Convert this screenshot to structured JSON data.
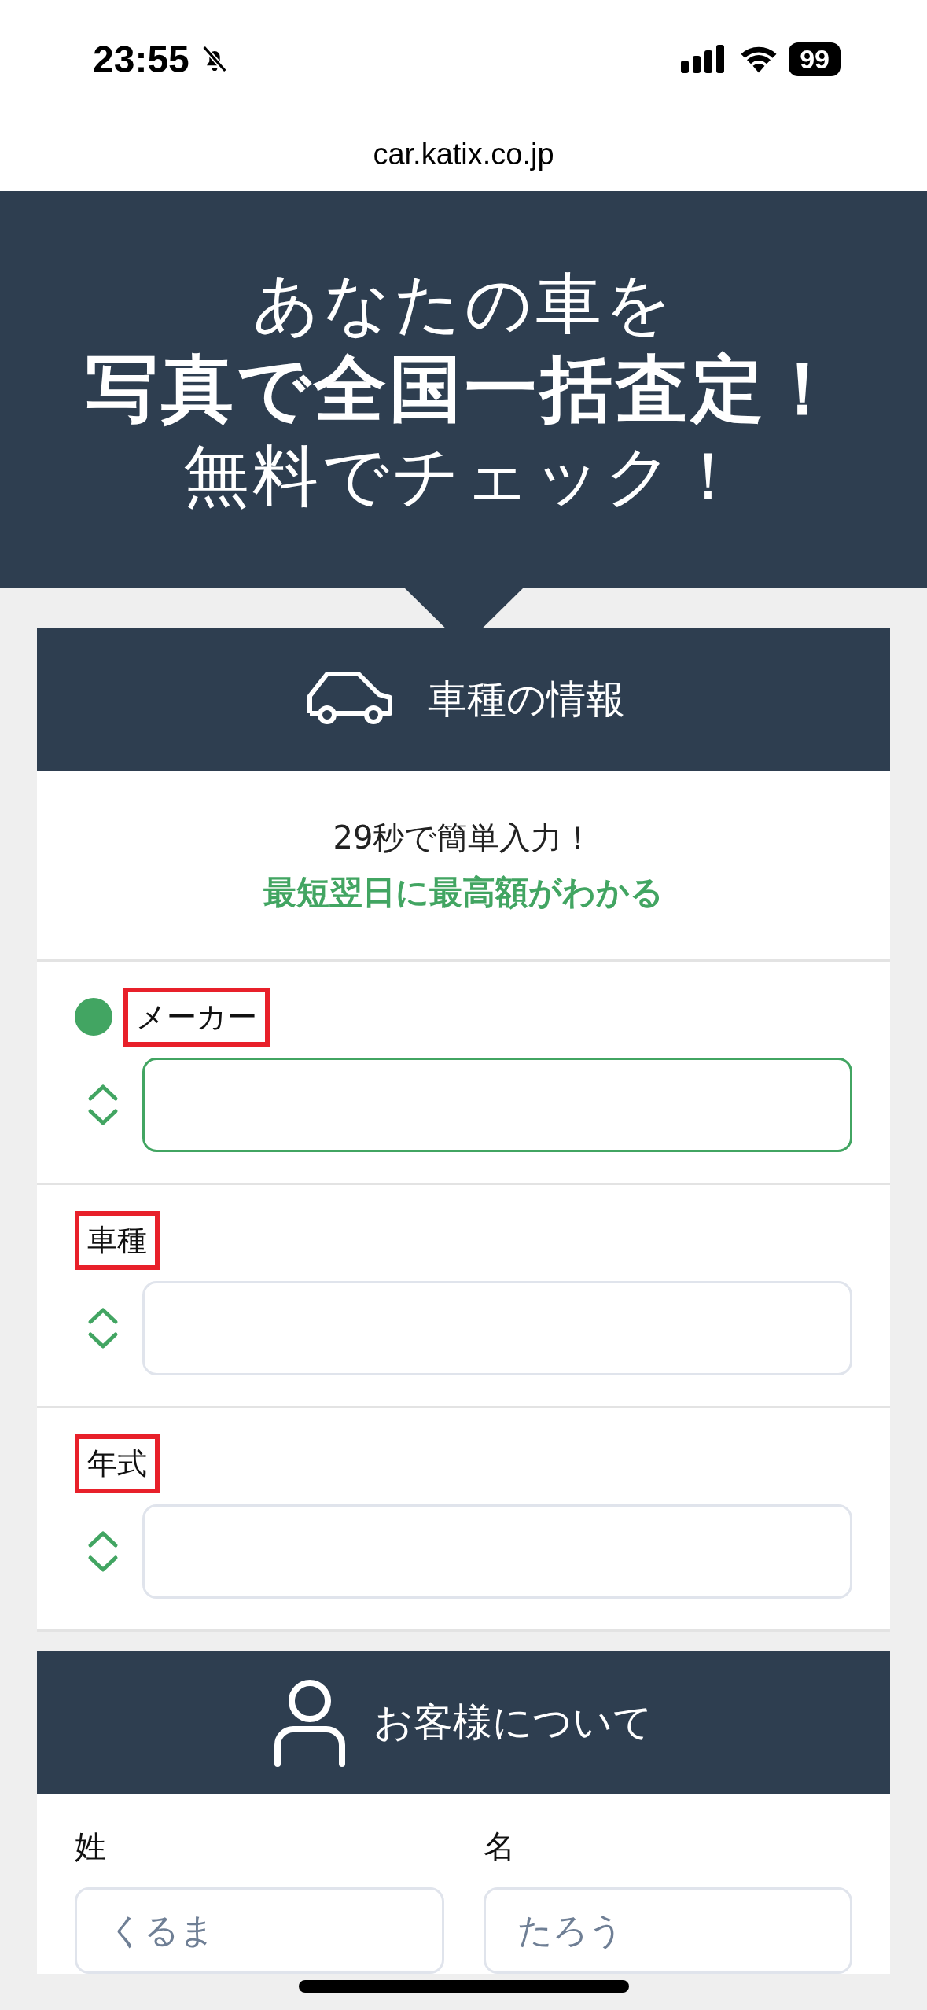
{
  "status_bar": {
    "time": "23:55",
    "silent": true,
    "battery": "99"
  },
  "address_bar": {
    "url": "car.katix.co.jp"
  },
  "hero": {
    "lines": [
      {
        "text": "あなたの車を",
        "kind": "light"
      },
      {
        "text": "写真で全国一括査定！",
        "kind": "bold"
      },
      {
        "text": "無料でチェック！",
        "kind": "light"
      }
    ]
  },
  "vehicle_section": {
    "title": "車種の情報",
    "intro": "29秒で簡単入力！",
    "highlight": "最短翌日に最高額がわかる",
    "fields": [
      {
        "label": "メーカー",
        "active": true,
        "highlighted": true
      },
      {
        "label": "車種",
        "active": false,
        "highlighted": true
      },
      {
        "label": "年式",
        "active": false,
        "highlighted": true
      }
    ]
  },
  "customer_section": {
    "title": "お客様について",
    "fields": [
      {
        "label": "姓",
        "placeholder": "くるま"
      },
      {
        "label": "名",
        "placeholder": "たろう"
      }
    ]
  }
}
